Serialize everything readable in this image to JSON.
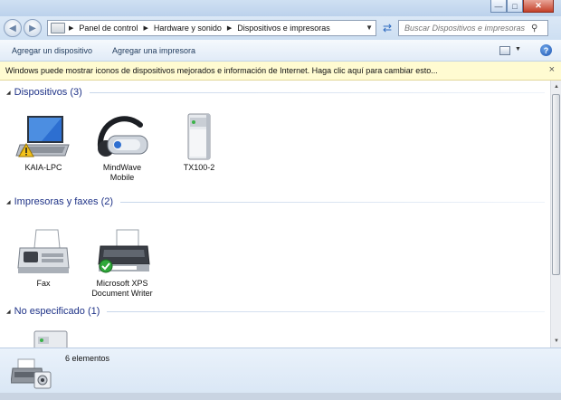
{
  "window": {
    "minimize_icon": "minimize-icon",
    "maximize_icon": "maximize-icon",
    "close_icon": "close-icon"
  },
  "nav": {
    "back_icon": "back-arrow-icon",
    "forward_icon": "forward-arrow-icon",
    "breadcrumbs": [
      "Panel de control",
      "Hardware y sonido",
      "Dispositivos e impresoras"
    ],
    "search_placeholder": "Buscar Dispositivos e impresoras"
  },
  "toolbar": {
    "add_device": "Agregar un dispositivo",
    "add_printer": "Agregar una impresora"
  },
  "infobar": {
    "message": "Windows puede mostrar iconos de dispositivos mejorados e información de Internet. Haga clic aquí para cambiar esto...",
    "close": "×"
  },
  "groups": [
    {
      "title": "Dispositivos (3)",
      "items": [
        {
          "label": "KAIA-LPC",
          "icon": "laptop-icon",
          "badge": "warning-icon"
        },
        {
          "label": "MindWave\nMobile",
          "icon": "headset-icon"
        },
        {
          "label": "TX100-2",
          "icon": "server-tower-icon"
        }
      ]
    },
    {
      "title": "Impresoras y faxes (2)",
      "items": [
        {
          "label": "Fax",
          "icon": "fax-icon"
        },
        {
          "label": "Microsoft XPS\nDocument Writer",
          "icon": "printer-icon",
          "badge": "default-check-icon"
        }
      ]
    },
    {
      "title": "No especificado (1)",
      "items": [
        {
          "label": "",
          "icon": "unspecified-device-icon"
        }
      ]
    }
  ],
  "details": {
    "count": "6 elementos",
    "icon": "devices-printers-icon"
  },
  "colors": {
    "accent": "#1e3287",
    "infobar_bg": "#fffbd1",
    "toolbar_text": "#1e395b"
  }
}
